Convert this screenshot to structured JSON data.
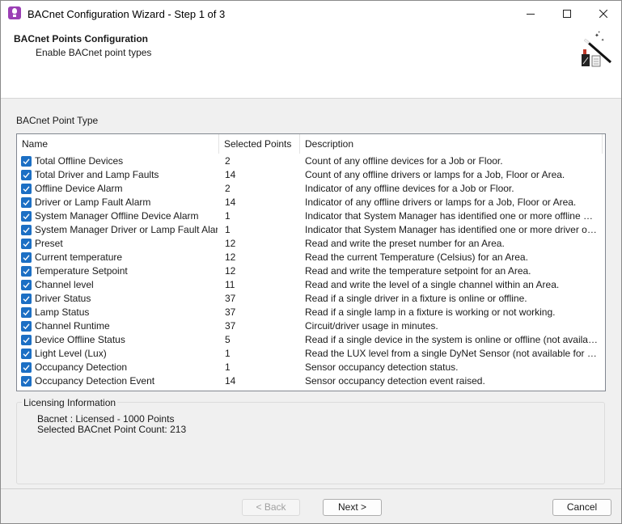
{
  "window": {
    "title": "BACnet Configuration Wizard - Step 1 of 3"
  },
  "header": {
    "title": "BACnet Points Configuration",
    "subtitle": "Enable BACnet point types"
  },
  "section_label": "BACnet Point Type",
  "list": {
    "columns": [
      "Name",
      "Selected Points",
      "Description"
    ],
    "rows": [
      {
        "checked": true,
        "name": "Total Offline Devices",
        "selected": "2",
        "description": "Count of any offline devices for a Job or Floor."
      },
      {
        "checked": true,
        "name": "Total Driver and Lamp Faults",
        "selected": "14",
        "description": "Count of any offline drivers or lamps for a Job, Floor or Area."
      },
      {
        "checked": true,
        "name": "Offline Device Alarm",
        "selected": "2",
        "description": "Indicator of any offline devices for a Job or Floor."
      },
      {
        "checked": true,
        "name": "Driver or Lamp Fault Alarm",
        "selected": "14",
        "description": "Indicator of any offline drivers or lamps for a Job, Floor or Area."
      },
      {
        "checked": true,
        "name": "System Manager Offline Device Alarm",
        "selected": "1",
        "description": "Indicator that System Manager has identified one or more offline devices."
      },
      {
        "checked": true,
        "name": "System Manager Driver or Lamp Fault Alarm",
        "selected": "1",
        "description": "Indicator that System Manager has identified one or more driver or lamp fail..."
      },
      {
        "checked": true,
        "name": "Preset",
        "selected": "12",
        "description": "Read and write the preset number for an Area."
      },
      {
        "checked": true,
        "name": "Current temperature",
        "selected": "12",
        "description": "Read the current Temperature (Celsius) for an Area."
      },
      {
        "checked": true,
        "name": "Temperature Setpoint",
        "selected": "12",
        "description": "Read and write the temperature setpoint for an Area."
      },
      {
        "checked": true,
        "name": "Channel level",
        "selected": "11",
        "description": "Read and write the level of a single channel within an Area."
      },
      {
        "checked": true,
        "name": "Driver Status",
        "selected": "37",
        "description": "Read if a single driver in a fixture is online or offline."
      },
      {
        "checked": true,
        "name": "Lamp Status",
        "selected": "37",
        "description": "Read if a single lamp in a fixture is working or not working."
      },
      {
        "checked": true,
        "name": "Channel Runtime",
        "selected": "37",
        "description": "Circuit/driver usage in minutes."
      },
      {
        "checked": true,
        "name": "Device Offline Status",
        "selected": "5",
        "description": "Read if a single device in the system is online or offline (not available for D..."
      },
      {
        "checked": true,
        "name": "Light Level (Lux)",
        "selected": "1",
        "description": "Read the LUX level from a single DyNet Sensor (not available for DALI sen..."
      },
      {
        "checked": true,
        "name": "Occupancy Detection",
        "selected": "1",
        "description": "Sensor occupancy detection status."
      },
      {
        "checked": true,
        "name": "Occupancy Detection Event",
        "selected": "14",
        "description": "Sensor occupancy detection event raised."
      }
    ]
  },
  "licensing": {
    "title": "Licensing Information",
    "line1": "Bacnet : Licensed - 1000 Points",
    "line2": "Selected BACnet Point Count: 213"
  },
  "buttons": {
    "back": "< Back",
    "next": "Next >",
    "cancel": "Cancel"
  },
  "colors": {
    "checkbox": "#1c6fc4",
    "app_icon": "#9b3fb5"
  }
}
